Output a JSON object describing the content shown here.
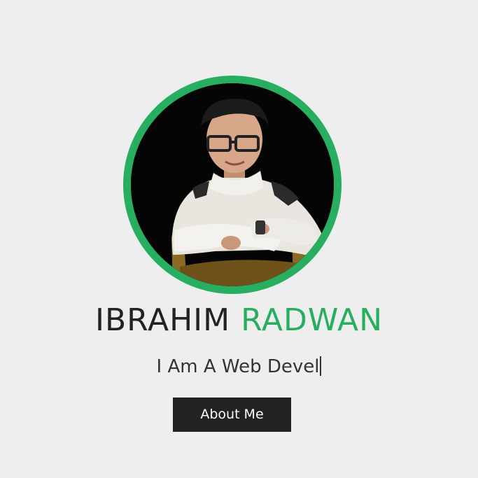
{
  "hero": {
    "first_name": "IBRAHIM",
    "last_name": "RADWAN",
    "tagline": "I Am A Web Devel",
    "about_button_label": "About Me",
    "accent_color": "#27ae60",
    "dark_color": "#222222",
    "background_color": "#eeeeee"
  }
}
